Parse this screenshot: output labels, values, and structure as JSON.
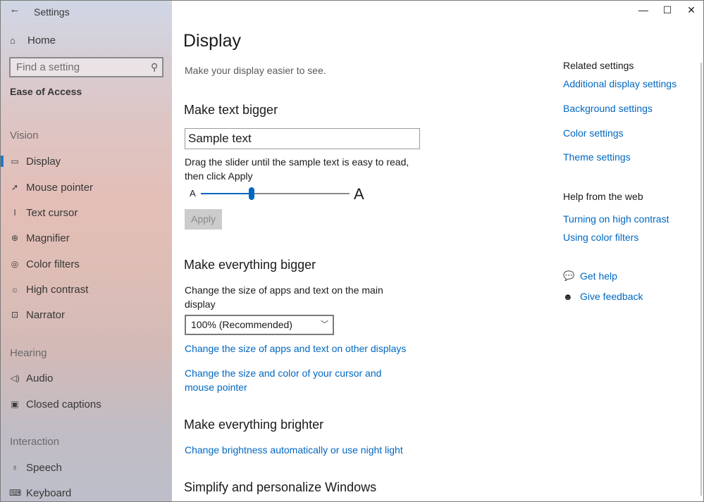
{
  "app": {
    "title": "Settings",
    "back": "←"
  },
  "window_controls": {
    "minimize": "—",
    "maximize": "☐",
    "close": "✕"
  },
  "sidebar": {
    "home": "Home",
    "search_placeholder": "Find a setting",
    "section": "Ease of Access",
    "groups": [
      {
        "label": "Vision",
        "items": [
          "Display",
          "Mouse pointer",
          "Text cursor",
          "Magnifier",
          "Color filters",
          "High contrast",
          "Narrator"
        ]
      },
      {
        "label": "Hearing",
        "items": [
          "Audio",
          "Closed captions"
        ]
      },
      {
        "label": "Interaction",
        "items": [
          "Speech",
          "Keyboard"
        ]
      }
    ],
    "active_item": "Display"
  },
  "main": {
    "title": "Display",
    "subtitle": "Make your display easier to see.",
    "text_bigger": {
      "heading": "Make text bigger",
      "sample": "Sample text",
      "description": "Drag the slider until the sample text is easy to read, then click Apply",
      "slider_small": "A",
      "slider_large": "A",
      "slider_level": 0.34,
      "apply": "Apply"
    },
    "everything_bigger": {
      "heading": "Make everything bigger",
      "description": "Change the size of apps and text on the main display",
      "dropdown_value": "100% (Recommended)",
      "link_other_displays": "Change the size of apps and text on other displays",
      "link_cursor": "Change the size and color of your cursor and mouse pointer"
    },
    "brighter": {
      "heading": "Make everything brighter",
      "link": "Change brightness automatically or use night light"
    },
    "simplify": {
      "heading": "Simplify and personalize Windows"
    }
  },
  "related": {
    "heading": "Related settings",
    "links": [
      "Additional display settings",
      "Background settings",
      "Color settings",
      "Theme settings"
    ],
    "help_heading": "Help from the web",
    "help_links": [
      "Turning on high contrast",
      "Using color filters"
    ],
    "get_help": "Get help",
    "give_feedback": "Give feedback"
  },
  "colors": {
    "accent": "#0067c0",
    "text": "#1a1a1a"
  }
}
